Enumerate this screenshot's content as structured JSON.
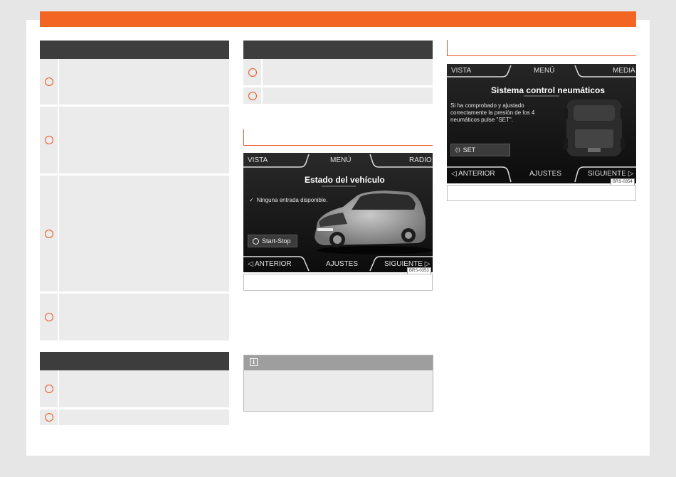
{
  "colors": {
    "accent": "#f26522",
    "table_header": "#3d3d3d",
    "row_bg": "#ebebeb",
    "note_header": "#9e9e9e"
  },
  "figure_vehicle": {
    "tabs": {
      "left": "VISTA",
      "center": "MENÚ",
      "right": "RADIO"
    },
    "title": "Estado del vehículo",
    "message": "Ninguna entrada disponible.",
    "button": "Start-Stop",
    "bottom": {
      "left": "ANTERIOR",
      "center": "AJUSTES",
      "right": "SIGUIENTE"
    },
    "code": "BRS-0353"
  },
  "figure_tyre": {
    "tabs": {
      "left": "VISTA",
      "center": "MENÚ",
      "right": "MEDIA"
    },
    "title": "Sistema control neumáticos",
    "message": "Si ha comprobado y ajustado correctamente la presión de los 4 neumáticos pulse \"SET\".",
    "button": "SET",
    "bottom": {
      "left": "ANTERIOR",
      "center": "AJUSTES",
      "right": "SIGUIENTE"
    },
    "code": "BRS-0354"
  },
  "icons": {
    "left_arrow": "◁",
    "right_arrow": "▷",
    "check": "✓",
    "info": "i",
    "tyre_warning": "(!)"
  }
}
